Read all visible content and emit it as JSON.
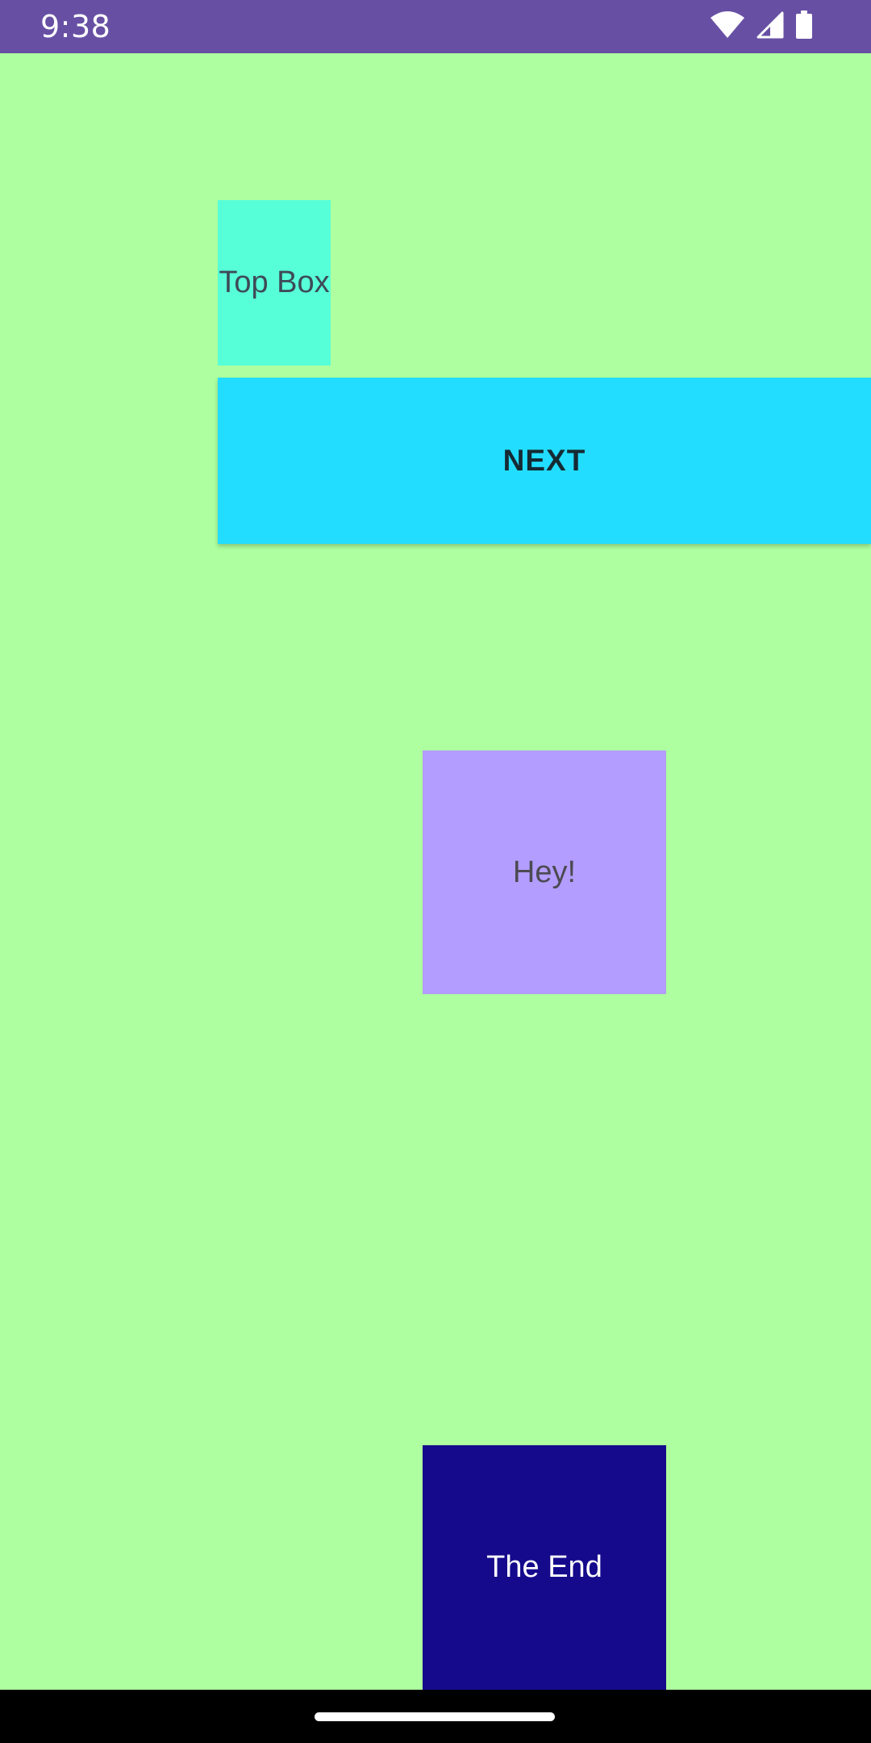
{
  "status_bar": {
    "time": "9:38",
    "background": "#6750a4",
    "icons": [
      "wifi-icon",
      "cellular-signal-icon",
      "battery-icon"
    ]
  },
  "screen": {
    "background": "#adff9f"
  },
  "top_box": {
    "label": "Top Box",
    "color": "#57ffd8"
  },
  "next_button": {
    "label": "NEXT",
    "color": "#22ddff"
  },
  "hey_box": {
    "label": "Hey!",
    "color": "#b39dff"
  },
  "end_box": {
    "label": "The End",
    "color": "#150a8c"
  }
}
